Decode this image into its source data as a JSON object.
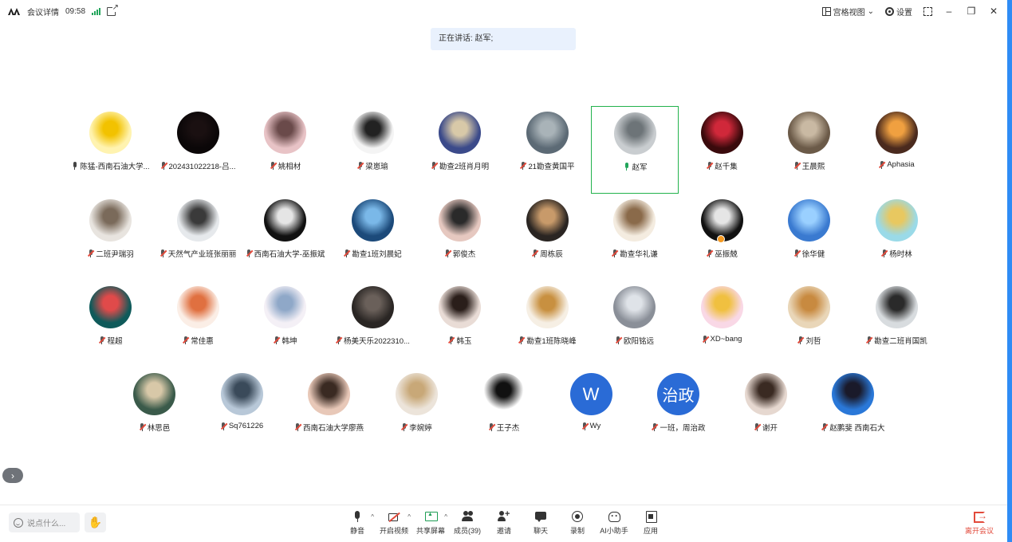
{
  "titlebar": {
    "meeting_details": "会议详情",
    "time": "09:58",
    "colors": {
      "signal": "#22a55b"
    },
    "layout_label": "宫格视图",
    "settings_label": "设置"
  },
  "speaking_banner": "正在讲话: 赵军;",
  "participants": [
    {
      "name": "陈猛-西南石油大学...",
      "mic": "on",
      "avatar_bg": "#fff3b0",
      "avatar_fg": "#f2c200"
    },
    {
      "name": "202431022218-吕...",
      "mic": "muted",
      "avatar_bg": "#0b0708",
      "avatar_fg": "#1a1011"
    },
    {
      "name": "姚相材",
      "mic": "muted",
      "avatar_bg": "#e8c3c6",
      "avatar_fg": "#6a4a4a"
    },
    {
      "name": "梁崽瑜",
      "mic": "muted",
      "avatar_bg": "#f4f4f4",
      "avatar_fg": "#222222"
    },
    {
      "name": "勘查2班肖月明",
      "mic": "muted",
      "avatar_bg": "#3b4a8a",
      "avatar_fg": "#d8c9a8"
    },
    {
      "name": "21勘查黄国平",
      "mic": "muted",
      "avatar_bg": "#5c6a75",
      "avatar_fg": "#a9b3b8"
    },
    {
      "name": "赵军",
      "mic": "talking",
      "active": true,
      "avatar_bg": "#c9cdd0",
      "avatar_fg": "#6d7478"
    },
    {
      "name": "赵千集",
      "mic": "muted",
      "avatar_bg": "#3a0a0c",
      "avatar_fg": "#d0283a"
    },
    {
      "name": "王晨熙",
      "mic": "muted",
      "avatar_bg": "#6b5a48",
      "avatar_fg": "#c9b9a3"
    },
    {
      "name": "Aphasia",
      "mic": "muted",
      "avatar_bg": "#4a2a1e",
      "avatar_fg": "#f0a040"
    },
    {
      "name": "二班尹瑞羽",
      "mic": "muted",
      "avatar_bg": "#e8e4df",
      "avatar_fg": "#7a6a5a"
    },
    {
      "name": "天然气产业班张丽丽",
      "mic": "muted",
      "avatar_bg": "#e6e9ec",
      "avatar_fg": "#3a3a3a"
    },
    {
      "name": "西南石油大学-巫振斌",
      "mic": "muted",
      "avatar_bg": "#111111",
      "avatar_fg": "#e5e5e5"
    },
    {
      "name": "勘查1班刘晨妃",
      "mic": "muted",
      "avatar_bg": "#1c4a7a",
      "avatar_fg": "#7ab8e8"
    },
    {
      "name": "郭俊杰",
      "mic": "muted",
      "avatar_bg": "#e6c8c0",
      "avatar_fg": "#2a2a2a"
    },
    {
      "name": "周栋辰",
      "mic": "muted",
      "avatar_bg": "#2a2522",
      "avatar_fg": "#c89a6a"
    },
    {
      "name": "勘查华礼谦",
      "mic": "muted",
      "avatar_bg": "#f4ece0",
      "avatar_fg": "#8a6a4a"
    },
    {
      "name": "巫振兢",
      "mic": "muted",
      "badge": true,
      "avatar_bg": "#111111",
      "avatar_fg": "#e5e5e5"
    },
    {
      "name": "徐华健",
      "mic": "muted",
      "avatar_bg": "#3a7ad0",
      "avatar_fg": "#9ad0ff"
    },
    {
      "name": "杨时林",
      "mic": "muted",
      "avatar_bg": "#9adae8",
      "avatar_fg": "#e8c860"
    },
    {
      "name": "程超",
      "mic": "muted",
      "avatar_bg": "#0f5a5a",
      "avatar_fg": "#e04a4a"
    },
    {
      "name": "常佳惠",
      "mic": "muted",
      "avatar_bg": "#fbeee6",
      "avatar_fg": "#e07040"
    },
    {
      "name": "韩坤",
      "mic": "muted",
      "avatar_bg": "#f4f0f6",
      "avatar_fg": "#8fa8c8"
    },
    {
      "name": "杨美天乐2022310...",
      "mic": "muted",
      "avatar_bg": "#2a2624",
      "avatar_fg": "#6a605a"
    },
    {
      "name": "韩玉",
      "mic": "muted",
      "avatar_bg": "#e9dcd6",
      "avatar_fg": "#2a1e1a"
    },
    {
      "name": "勘查1班陈晓峰",
      "mic": "muted",
      "avatar_bg": "#f6efe4",
      "avatar_fg": "#c89040"
    },
    {
      "name": "欧阳铭远",
      "mic": "muted",
      "avatar_bg": "#8a8f98",
      "avatar_fg": "#dfe3e8"
    },
    {
      "name": "XD~bang",
      "mic": "muted",
      "avatar_bg": "#f9d8e6",
      "avatar_fg": "#f0c040"
    },
    {
      "name": "刘哲",
      "mic": "muted",
      "avatar_bg": "#e9d6b8",
      "avatar_fg": "#c88a40"
    },
    {
      "name": "勘查二班肖国凯",
      "mic": "muted",
      "avatar_bg": "#d8dcdf",
      "avatar_fg": "#2a2a2a"
    },
    {
      "name": "林思邑",
      "mic": "muted",
      "avatar_bg": "#3a5a4a",
      "avatar_fg": "#d8c8a8"
    },
    {
      "name": "Sq761226",
      "mic": "muted",
      "avatar_bg": "#b8c8d8",
      "avatar_fg": "#3a4a5a"
    },
    {
      "name": "西南石油大学廖燕",
      "mic": "muted",
      "avatar_bg": "#e8c8b8",
      "avatar_fg": "#3a2a22"
    },
    {
      "name": "李婉婷",
      "mic": "muted",
      "avatar_bg": "#ece4da",
      "avatar_fg": "#c8a878"
    },
    {
      "name": "王子杰",
      "mic": "muted",
      "avatar_bg": "#ffffff",
      "avatar_fg": "#111111"
    },
    {
      "name": "Wy",
      "mic": "muted",
      "letter": "W",
      "avatar_bg": "#2a6bd6",
      "avatar_fg": "#ffffff"
    },
    {
      "name": "一班，周治政",
      "mic": "muted",
      "letter": "治政",
      "avatar_bg": "#2a6bd6",
      "avatar_fg": "#ffffff"
    },
    {
      "name": "谢开",
      "mic": "muted",
      "avatar_bg": "#e6d8d0",
      "avatar_fg": "#3a2a22"
    },
    {
      "name": "赵鹏斐 西南石大",
      "mic": "muted",
      "avatar_bg": "#2a78d8",
      "avatar_fg": "#1a1a2a"
    }
  ],
  "chat": {
    "placeholder": "说点什么..."
  },
  "toolbar": [
    {
      "key": "mute",
      "label": "静音",
      "icon": "mic-icon",
      "caret": true
    },
    {
      "key": "video",
      "label": "开启视频",
      "icon": "camera-off-icon",
      "caret": true
    },
    {
      "key": "share",
      "label": "共享屏幕",
      "icon": "share-screen-icon",
      "caret": true
    },
    {
      "key": "members",
      "label": "成员(39)",
      "icon": "people-icon",
      "caret": false
    },
    {
      "key": "invite",
      "label": "邀请",
      "icon": "invite-icon",
      "caret": false
    },
    {
      "key": "chat",
      "label": "聊天",
      "icon": "chat-icon",
      "caret": false
    },
    {
      "key": "record",
      "label": "录制",
      "icon": "record-icon",
      "caret": false
    },
    {
      "key": "ai",
      "label": "AI小助手",
      "icon": "ai-assistant-icon",
      "caret": false
    },
    {
      "key": "apps",
      "label": "应用",
      "icon": "apps-icon",
      "caret": false
    }
  ],
  "leave_label": "离开会议",
  "colors": {
    "accent": "#2f8cf5",
    "active_border": "#22b24c",
    "leave": "#e24a3b"
  }
}
